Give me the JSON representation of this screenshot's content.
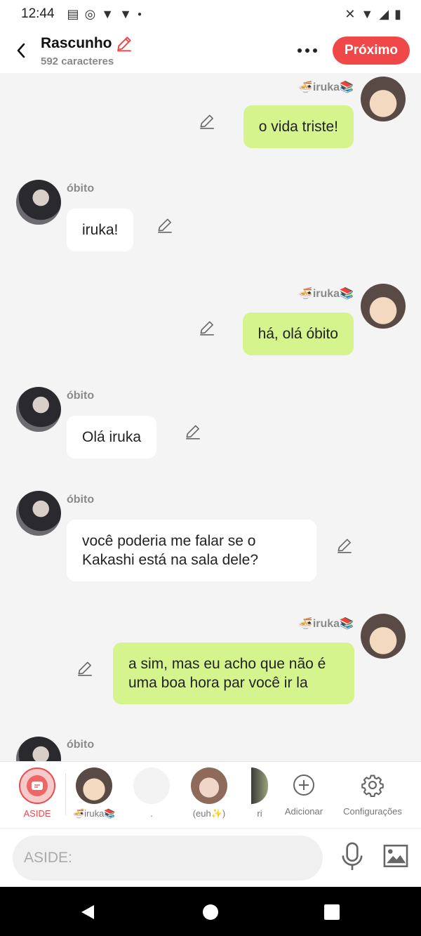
{
  "status_bar": {
    "time": "12:44"
  },
  "header": {
    "title": "Rascunho",
    "subtitle": "592 caracteres",
    "next_label": "Próximo"
  },
  "messages": [
    {
      "author": "🍜iruka📚",
      "text": "o vida triste!"
    },
    {
      "author": "óbito",
      "text": "iruka!"
    },
    {
      "author": "🍜iruka📚",
      "text": "há, olá óbito"
    },
    {
      "author": "óbito",
      "text": "Olá iruka"
    },
    {
      "author": "óbito",
      "text": "você poderia me falar se o Kakashi está na sala dele?"
    },
    {
      "author": "🍜iruka📚",
      "text": "a sim, mas eu acho que não é uma boa hora par você ir la"
    },
    {
      "author": "óbito",
      "text": ""
    }
  ],
  "tabs": [
    {
      "label": "ASIDE"
    },
    {
      "label": "🍜iruka📚"
    },
    {
      "label": "."
    },
    {
      "label": "(euh✨)"
    },
    {
      "label": "ri"
    },
    {
      "label": "Adicionar"
    },
    {
      "label": "Configurações"
    }
  ],
  "input": {
    "placeholder": "ASIDE:"
  },
  "colors": {
    "accent": "#f04848",
    "my_bubble": "#d6f48d",
    "their_bubble": "#ffffff"
  }
}
